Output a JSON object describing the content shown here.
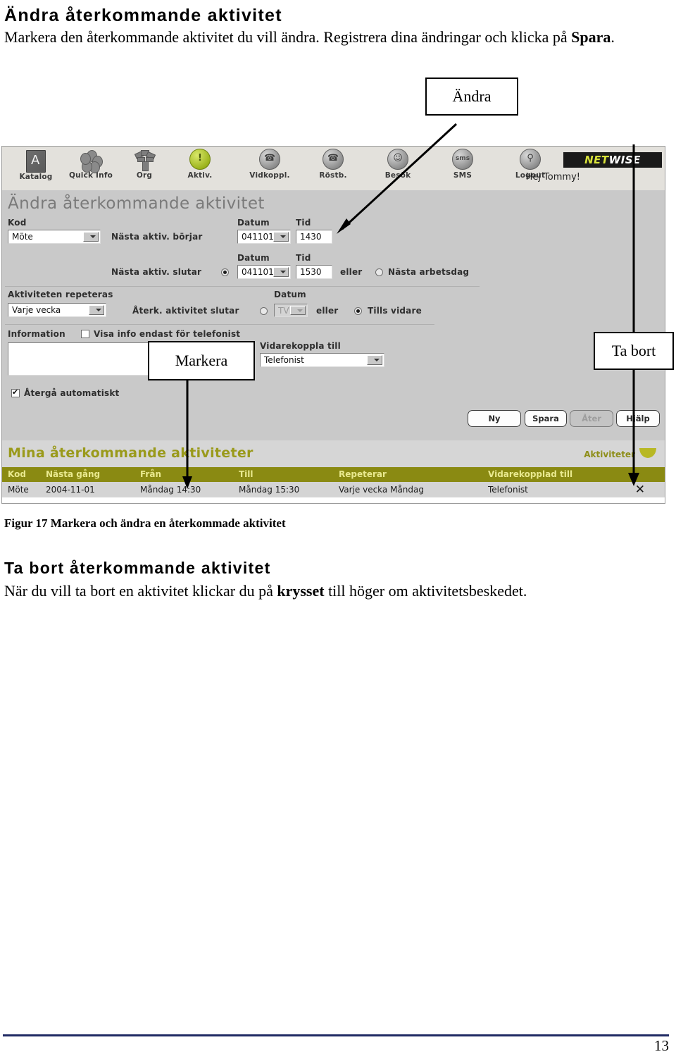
{
  "document": {
    "heading1": "Ändra återkommande aktivitet",
    "para1_a": "Markera den återkommande aktivitet du vill ändra. Registrera dina ändringar och klicka på ",
    "para1_bold": "Spara",
    "para1_b": ".",
    "figure_caption": "Figur 17  Markera och ändra en återkommade aktivitet",
    "heading2": "Ta bort återkommande aktivitet",
    "para2_a": "När du vill ta bort en aktivitet klickar du på ",
    "para2_bold": "krysset",
    "para2_b": " till höger om aktivitetsbeskedet.",
    "page_number": "13"
  },
  "callouts": {
    "andra": "Ändra",
    "markera": "Markera",
    "ta_bort": "Ta bort"
  },
  "screenshot": {
    "toolbar": {
      "items": [
        {
          "label": "Katalog",
          "icon": "book-icon"
        },
        {
          "label": "Quick Info",
          "icon": "flower-icon"
        },
        {
          "label": "Org",
          "icon": "tree-icon"
        },
        {
          "label": "Aktiv.",
          "icon": "alert-icon"
        },
        {
          "label": "Vidkoppl.",
          "icon": "phone-forward-icon"
        },
        {
          "label": "Röstb.",
          "icon": "voicemail-icon"
        },
        {
          "label": "Besök",
          "icon": "visitor-icon"
        },
        {
          "label": "SMS",
          "icon": "sms-icon"
        },
        {
          "label": "Logout",
          "icon": "key-icon"
        }
      ],
      "brand_a": "NET",
      "brand_b": "WISE",
      "greeting": "Hej Tommy!"
    },
    "form": {
      "title": "Ändra återkommande aktivitet",
      "kod_label": "Kod",
      "kod_value": "Möte",
      "start_label": "Nästa aktiv. börjar",
      "start_datum_label": "Datum",
      "start_tid_label": "Tid",
      "start_datum_value": "041101",
      "start_tid_value": "1430",
      "end_label": "Nästa aktiv. slutar",
      "end_datum_label": "Datum",
      "end_tid_label": "Tid",
      "end_datum_value": "041101",
      "end_tid_value": "1530",
      "eller_1": "eller",
      "nasta_arbetsdag": "Nästa arbetsdag",
      "repeat_label": "Aktiviteten repeteras",
      "repeat_value": "Varje vecka",
      "repeat_end_label": "Återk. aktivitet slutar",
      "repeat_datum_label": "Datum",
      "repeat_datum_value": "TV",
      "eller_2": "eller",
      "tills_vidare": "Tills vidare",
      "information_label": "Information",
      "visa_info_label": "Visa info endast för telefonist",
      "info_value": "",
      "atergd_label": "Återgå automatiskt",
      "vidare_label": "Vidarekoppla till",
      "vidare_value": "Telefonist",
      "buttons": [
        {
          "label": "Ny",
          "disabled": false
        },
        {
          "label": "Spara",
          "disabled": false
        },
        {
          "label": "Åter",
          "disabled": true
        },
        {
          "label": "Hjälp",
          "disabled": false
        }
      ]
    },
    "list": {
      "title": "Mina återkommande aktiviteter",
      "tab_label": "Aktiviteter",
      "columns": [
        "Kod",
        "Nästa gång",
        "Från",
        "Till",
        "Repeterar",
        "Vidarekopplad till"
      ],
      "rows": [
        {
          "kod": "Möte",
          "nasta_gang": "2004-11-01",
          "fran": "Måndag 14:30",
          "till": "Måndag 15:30",
          "repeterar": "Varje vecka Måndag",
          "vidarekopplad": "Telefonist",
          "delete": "✕"
        }
      ]
    }
  },
  "colors": {
    "olive_header": "#8a8a12",
    "olive_text": "#9a9a1b",
    "footer_rule": "#1f2a63",
    "app_bg": "#c9c9c9"
  }
}
